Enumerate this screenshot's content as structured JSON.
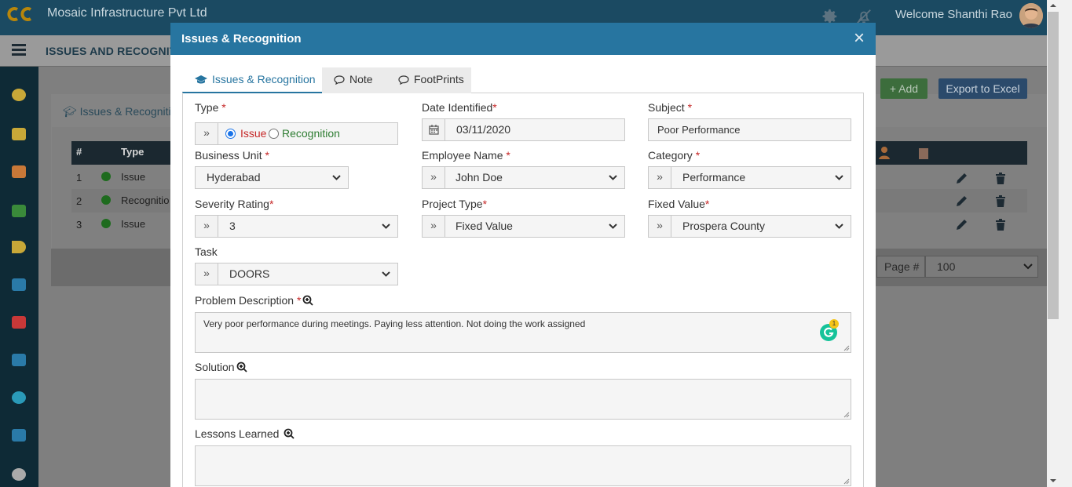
{
  "app": {
    "company": "Mosaic Infrastructure Pvt Ltd",
    "welcome": "Welcome Shanthi Rao",
    "page_heading": "ISSUES AND RECOGNIT"
  },
  "background": {
    "tab_label": "Issues & Recogniti",
    "add_button": "+ Add",
    "export_button": "Export to Excel",
    "table_headers": [
      "#",
      "Type"
    ],
    "rows": [
      {
        "num": "1",
        "type": "Issue"
      },
      {
        "num": "2",
        "type": "Recognitio"
      },
      {
        "num": "3",
        "type": "Issue"
      }
    ],
    "page_label": "Page #",
    "page_size": "100"
  },
  "modal": {
    "title": "Issues & Recognition",
    "close": "×",
    "tabs": [
      "Issues & Recognition",
      "Note",
      "FootPrints"
    ],
    "form": {
      "type_label": "Type",
      "type_options": [
        "Issue",
        "Recognition"
      ],
      "type_selected": "Issue",
      "date_label": "Date Identified",
      "date_value": "03/11/2020",
      "subject_label": "Subject",
      "subject_value": "Poor Performance",
      "bu_label": "Business Unit",
      "bu_value": "Hyderabad",
      "emp_label": "Employee Name",
      "emp_value": "John Doe",
      "cat_label": "Category",
      "cat_value": "Performance",
      "sev_label": "Severity Rating",
      "sev_value": "3",
      "ptype_label": "Project Type",
      "ptype_value": "Fixed Value",
      "fixed_label": "Fixed Value",
      "fixed_value": "Prospera County",
      "task_label": "Task",
      "task_value": "DOORS",
      "problem_label": "Problem Description",
      "problem_value": "Very poor performance during meetings. Paying less attention. Not doing the work assigned",
      "grammarly_count": "1",
      "solution_label": "Solution",
      "solution_value": "",
      "lessons_label": "Lessons Learned",
      "lessons_value": "",
      "addon_glyph": "»",
      "required_mark": "*"
    }
  },
  "colors": {
    "header_blue": "#2775a0",
    "issue_red": "#c62828",
    "recognition_green": "#2e7d32",
    "topbar": "#1b4a62"
  }
}
